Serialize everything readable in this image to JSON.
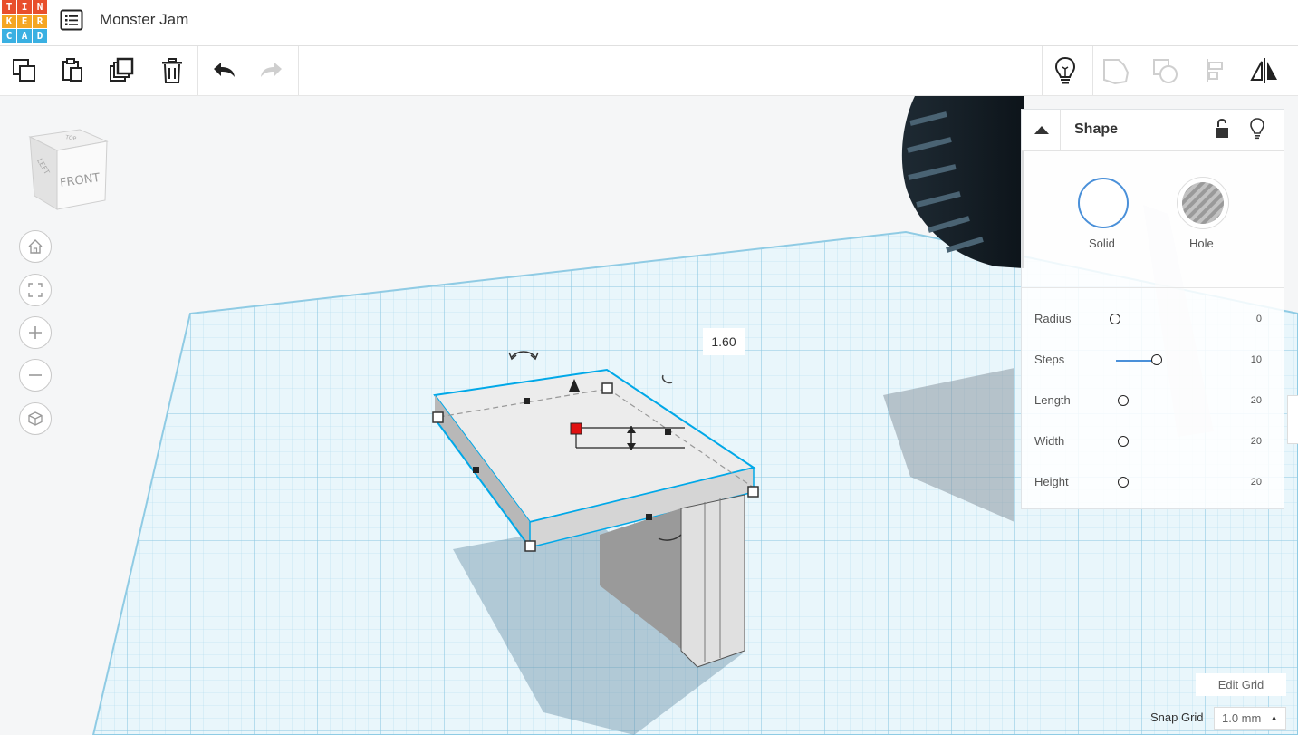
{
  "app": {
    "logo_letters": [
      "T",
      "I",
      "N",
      "K",
      "E",
      "R",
      "C",
      "A",
      "D"
    ],
    "logo_colors": [
      "#e84f2c",
      "#e84f2c",
      "#e84f2c",
      "#f5a623",
      "#f5a623",
      "#f5a623",
      "#3ab0e2",
      "#3ab0e2",
      "#3ab0e2"
    ],
    "project_title": "Monster Jam"
  },
  "toolbar": {
    "left_icons": [
      "copy-icon",
      "paste-icon",
      "duplicate-icon",
      "delete-icon",
      "undo-icon",
      "redo-icon"
    ],
    "right_icons": [
      "light-bulb-icon",
      "group-icon",
      "ungroup-icon",
      "align-icon",
      "mirror-icon"
    ]
  },
  "viewcube": {
    "face_front": "FRONT",
    "face_left": "LEFT",
    "face_top": "TOP"
  },
  "nav_icons": [
    "home-view-icon",
    "fit-view-icon",
    "zoom-in-icon",
    "zoom-out-icon",
    "perspective-icon"
  ],
  "selection": {
    "dimension_value": "1.60"
  },
  "shape_panel": {
    "title": "Shape",
    "solid_label": "Solid",
    "hole_label": "Hole",
    "params": [
      {
        "label": "Radius",
        "value": "0"
      },
      {
        "label": "Steps",
        "value": "10"
      },
      {
        "label": "Length",
        "value": "20"
      },
      {
        "label": "Width",
        "value": "20"
      },
      {
        "label": "Height",
        "value": "20"
      }
    ]
  },
  "grid": {
    "edit_label": "Edit Grid",
    "snap_label": "Snap Grid",
    "snap_value": "1.0 mm",
    "snap_caret": "▲"
  },
  "colors": {
    "accent": "#4a90d9",
    "grid_blue": "#bfe3f2",
    "selection": "#00a8e8",
    "handle_red": "#e01010"
  }
}
